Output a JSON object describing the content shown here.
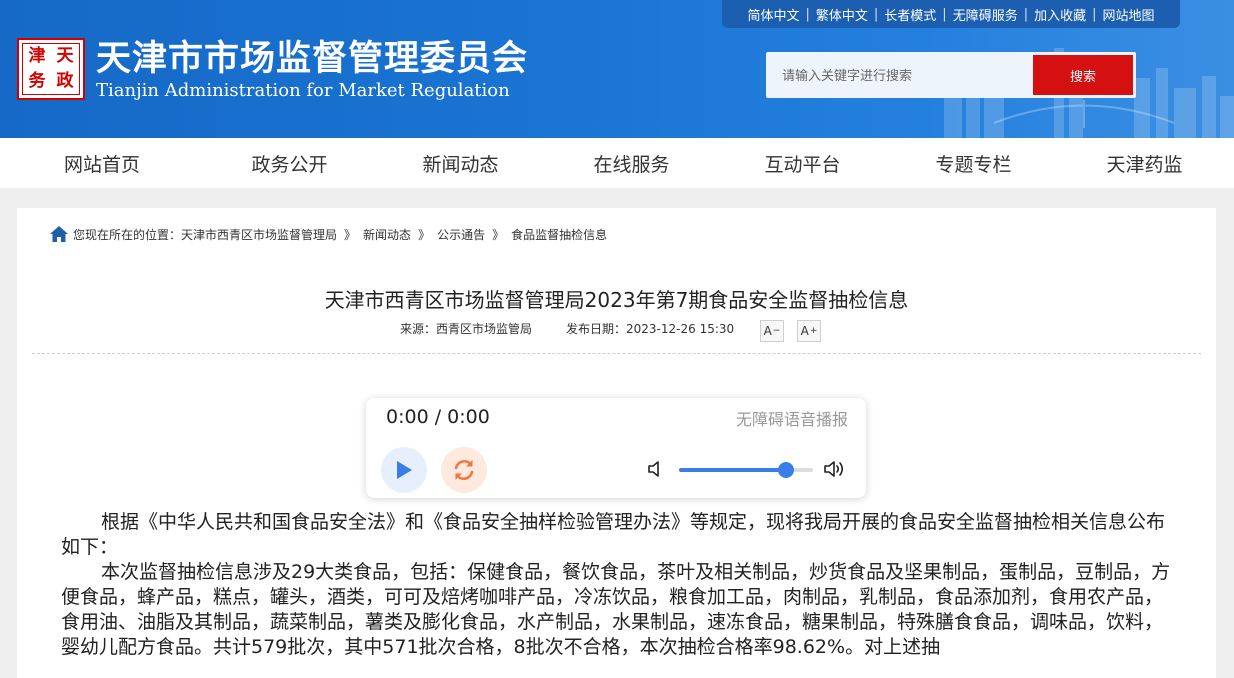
{
  "header": {
    "seal_chars": [
      "天",
      "津",
      "政",
      "务"
    ],
    "title": "天津市市场监督管理委员会",
    "subtitle": "Tianjin Administration for Market Regulation",
    "top_links": [
      "简体中文",
      "繁体中文",
      "长者模式",
      "无障碍服务",
      "加入收藏",
      "网站地图"
    ],
    "search": {
      "placeholder": "请输入关键字进行搜索",
      "button_label": "搜索"
    }
  },
  "nav": {
    "items": [
      "网站首页",
      "政务公开",
      "新闻动态",
      "在线服务",
      "互动平台",
      "专题专栏",
      "天津药监"
    ]
  },
  "breadcrumb": {
    "prefix": "您现在所在的位置：",
    "items": [
      "天津市西青区市场监督管理局",
      "新闻动态",
      "公示通告",
      "食品监督抽检信息"
    ],
    "separator": "》"
  },
  "article": {
    "title": "天津市西青区市场监督管理局2023年第7期食品安全监督抽检信息",
    "source": "来源：西青区市场监管局",
    "publish_date": "发布日期：2023-12-26 15:30",
    "font_decrease": "A",
    "font_increase": "A",
    "paragraphs": [
      "根据《中华人民共和国食品安全法》和《食品安全抽样检验管理办法》等规定，现将我局开展的食品安全监督抽检相关信息公布如下：",
      "本次监督抽检信息涉及29大类食品，包括：保健食品，餐饮食品，茶叶及相关制品，炒货食品及坚果制品，蛋制品，豆制品，方便食品，蜂产品，糕点，罐头，酒类，可可及焙烤咖啡产品，冷冻饮品，粮食加工品，肉制品，乳制品，食品添加剂，食用农产品，食用油、油脂及其制品，蔬菜制品，薯类及膨化食品，水产制品，水果制品，速冻食品，糖果制品，特殊膳食食品，调味品，饮料，婴幼儿配方食品。共计579批次，其中571批次合格，8批次不合格，本次抽检合格率98.62%。对上述抽"
    ]
  },
  "player": {
    "time": "0:00 / 0:00",
    "label": "无障碍语音播报",
    "volume": 0.8
  },
  "colors": {
    "header_blue": "#1a74d3",
    "search_red": "#d41010",
    "seal_red": "#d40000",
    "player_accent": "#3a7de8",
    "loop_orange": "#f0783c"
  },
  "icons": {
    "home": "home-icon",
    "play": "play-icon",
    "loop": "loop-icon",
    "volume_low": "volume-low-icon",
    "volume_high": "volume-high-icon"
  }
}
